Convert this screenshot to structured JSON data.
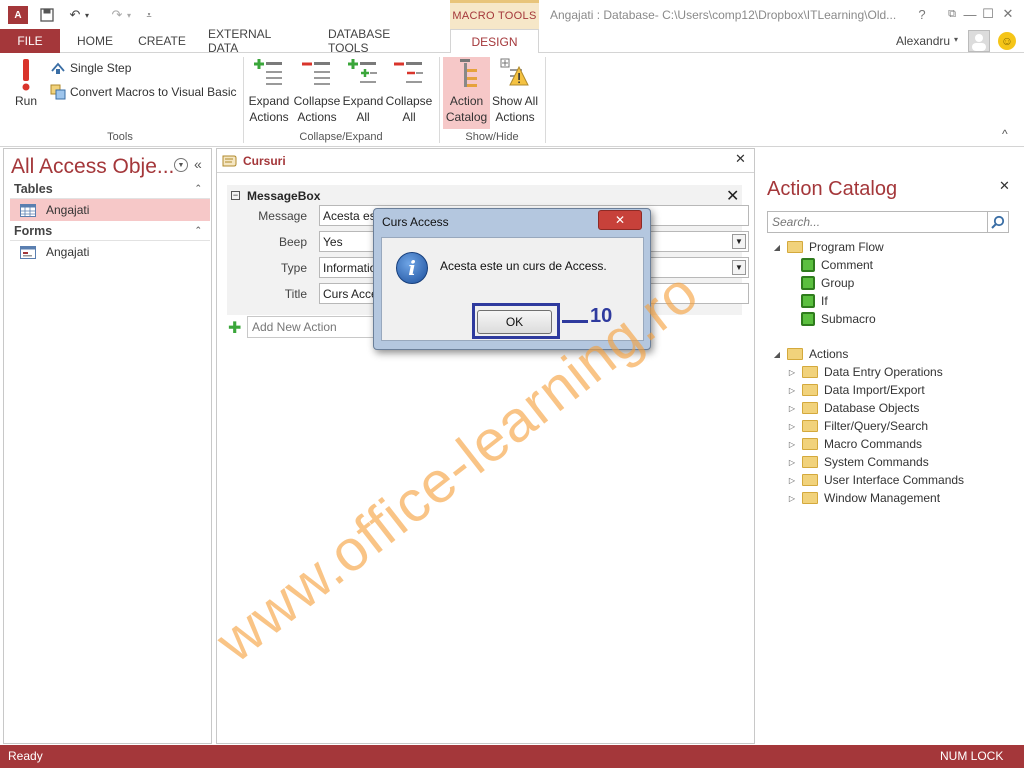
{
  "titlebar": {
    "logo_text": "A",
    "contextual_tab": "MACRO TOOLS",
    "window_title": "Angajati : Database- C:\\Users\\comp12\\Dropbox\\ITLearning\\Old...",
    "help": "?",
    "restore": "⧉",
    "minimize": "—",
    "maximize": "☐",
    "close": "✕"
  },
  "tabs": {
    "file": "FILE",
    "home": "HOME",
    "create": "CREATE",
    "external": "EXTERNAL DATA",
    "dbtools": "DATABASE TOOLS",
    "design": "DESIGN"
  },
  "user": {
    "name": "Alexandru",
    "dropdown": "▾"
  },
  "ribbon": {
    "run": "Run",
    "single_step": "Single Step",
    "convert": "Convert Macros to Visual Basic",
    "tools_label": "Tools",
    "expand_actions": [
      "Expand",
      "Actions"
    ],
    "collapse_actions": [
      "Collapse",
      "Actions"
    ],
    "expand_all": [
      "Expand",
      "All"
    ],
    "collapse_all": [
      "Collapse",
      "All"
    ],
    "collapse_expand_label": "Collapse/Expand",
    "action_catalog": [
      "Action",
      "Catalog"
    ],
    "show_all_actions": [
      "Show All",
      "Actions"
    ],
    "show_hide_label": "Show/Hide",
    "collapse_ribbon": "^"
  },
  "nav": {
    "title": "All Access Obje...",
    "tables_label": "Tables",
    "tables": [
      "Angajati"
    ],
    "forms_label": "Forms",
    "forms": [
      "Angajati"
    ]
  },
  "doc": {
    "tab_label": "Cursuri",
    "action_name": "MessageBox",
    "args": [
      {
        "label": "Message",
        "value": "Acesta este"
      },
      {
        "label": "Beep",
        "value": "Yes"
      },
      {
        "label": "Type",
        "value": "Information"
      },
      {
        "label": "Title",
        "value": "Curs Access"
      }
    ],
    "add_new_action": "Add New Action"
  },
  "catalog": {
    "title": "Action Catalog",
    "search_placeholder": "Search...",
    "program_flow": "Program Flow",
    "program_flow_items": [
      "Comment",
      "Group",
      "If",
      "Submacro"
    ],
    "actions": "Actions",
    "action_folders": [
      "Data Entry Operations",
      "Data Import/Export",
      "Database Objects",
      "Filter/Query/Search",
      "Macro Commands",
      "System Commands",
      "User Interface Commands",
      "Window Management"
    ]
  },
  "dialog": {
    "title": "Curs Access",
    "close": "✕",
    "message": "Acesta este un curs de Access.",
    "ok": "OK"
  },
  "annotation": {
    "step": "10"
  },
  "watermark": "www.office-learning.ro",
  "status": {
    "left": "Ready",
    "right": "NUM LOCK"
  },
  "colors": {
    "accent": "#a4373a",
    "annotation": "#2e3a9e",
    "watermark": "#f5a03c"
  }
}
